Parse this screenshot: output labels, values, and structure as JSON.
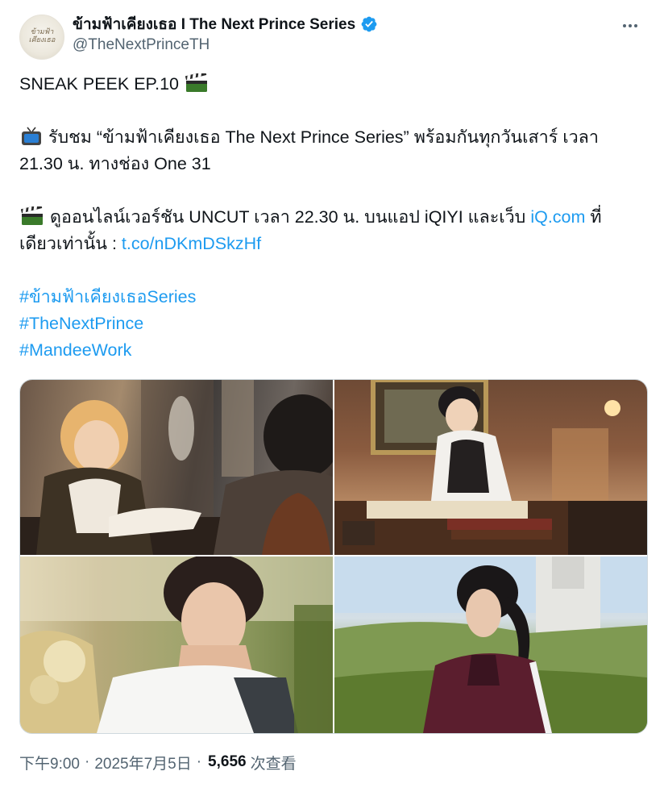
{
  "author": {
    "display_name": "ข้ามฟ้าเคียงเธอ I The Next Prince Series",
    "handle": "@TheNextPrinceTH",
    "avatar_text": "ข้ามฟ้า เคียงเธอ",
    "verified": true,
    "verified_color": "#1d9bf0"
  },
  "post": {
    "line_1": "SNEAK PEEK EP.10",
    "line_2_a": "รับชม “ข้ามฟ้าเคียงเธอ The Next Prince Series” พร้อมกันทุกวันเสาร์ เวลา",
    "line_2_b": "21.30 น. ทางช่อง One 31",
    "line_3_a_pre": "ดูออนไลน์เวอร์ชัน UNCUT เวลา 22.30 น. บนแอป iQIYI และเว็บ ",
    "line_3_a_link": "iQ.com",
    "line_3_a_post": " ที่",
    "line_3_b_pre": "เดียวเท่านั้น : ",
    "line_3_b_link": "t.co/nDKmDSkzHf",
    "hashtags": [
      "#ข้ามฟ้าเคียงเธอSeries",
      "#TheNextPrince",
      "#MandeeWork"
    ],
    "link_color": "#1d9bf0",
    "icons": [
      "clapperboard-icon",
      "television-icon"
    ]
  },
  "footer": {
    "time": "下午9:00",
    "separator": "·",
    "date": "2025年7月5日",
    "views_count": "5,656",
    "views_label": "次查看"
  }
}
